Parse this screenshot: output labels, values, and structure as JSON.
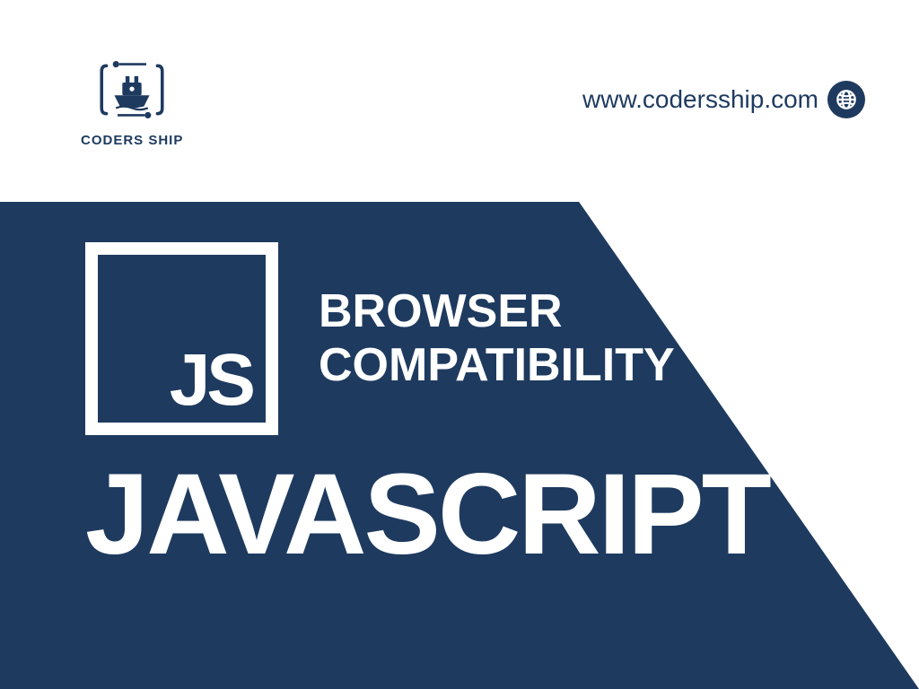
{
  "brand": {
    "name": "CODERS SHIP",
    "colors": {
      "primary": "#1e3a5f",
      "background": "#ffffff",
      "text_on_primary": "#ffffff"
    }
  },
  "header": {
    "url_text": "www.codersship.com"
  },
  "hero": {
    "badge_text": "JS",
    "subtitle_line_1": "BROWSER",
    "subtitle_line_2": "COMPATIBILITY",
    "main_title": "JAVASCRIPT"
  }
}
